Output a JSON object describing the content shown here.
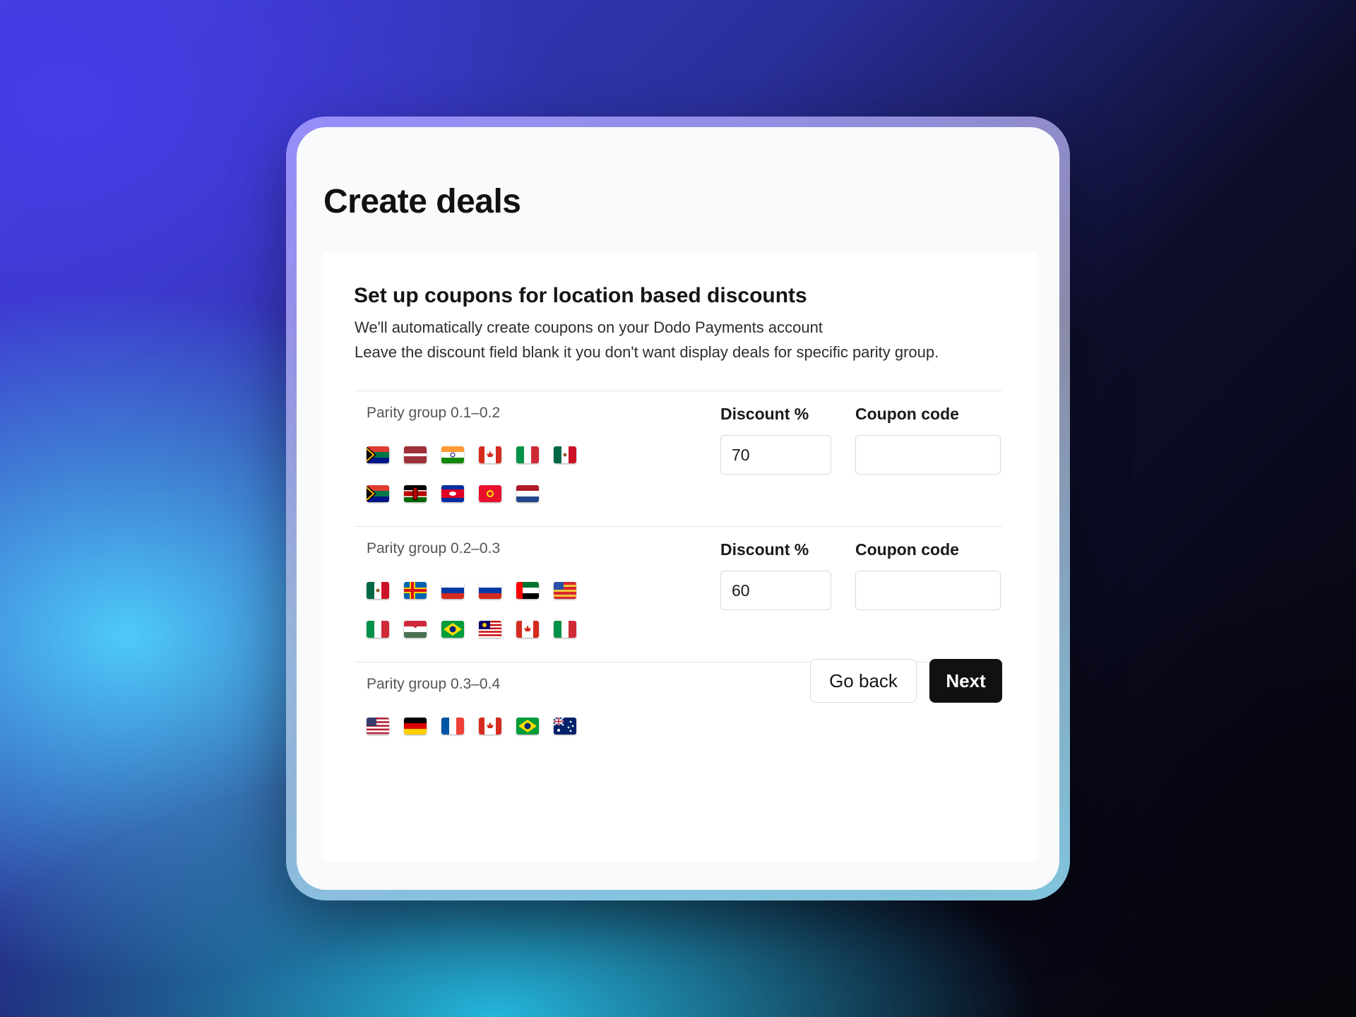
{
  "page": {
    "title": "Create deals",
    "heading": "Set up coupons for location based discounts",
    "description_line1": "We'll automatically create coupons on your Dodo Payments account",
    "description_line2": "Leave the discount field blank it you don't want display deals for specific parity group."
  },
  "labels": {
    "discount": "Discount %",
    "coupon": "Coupon code"
  },
  "groups": [
    {
      "label": "Parity group 0.1–0.2",
      "discount": "70",
      "coupon": "",
      "flags": [
        "south-africa-flag",
        "latvia-flag",
        "india-flag",
        "canada-flag",
        "italy-flag",
        "mexico-flag",
        "south-africa-flag",
        "kenya-flag",
        "cambodia-flag",
        "kyrgyzstan-flag",
        "netherlands-flag"
      ]
    },
    {
      "label": "Parity group 0.2–0.3",
      "discount": "60",
      "coupon": "",
      "flags": [
        "mexico-flag",
        "aland-flag",
        "russia-flag",
        "russia-flag",
        "uae-flag",
        "striped-flag",
        "italy-flag",
        "hungary-flag",
        "brazil-flag",
        "malaysia-flag",
        "canada-flag",
        "italy-flag"
      ]
    },
    {
      "label": "Parity group 0.3–0.4",
      "flags": [
        "usa-flag",
        "germany-flag",
        "france-flag",
        "canada-flag",
        "brazil-flag",
        "australia-flag"
      ]
    }
  ],
  "buttons": {
    "back": "Go back",
    "next": "Next"
  },
  "colors": {
    "primary_button": "#111111",
    "card": "#f9fafc",
    "accent_gradient_start": "#3f3fd8",
    "accent_gradient_end": "#44c8f5"
  }
}
